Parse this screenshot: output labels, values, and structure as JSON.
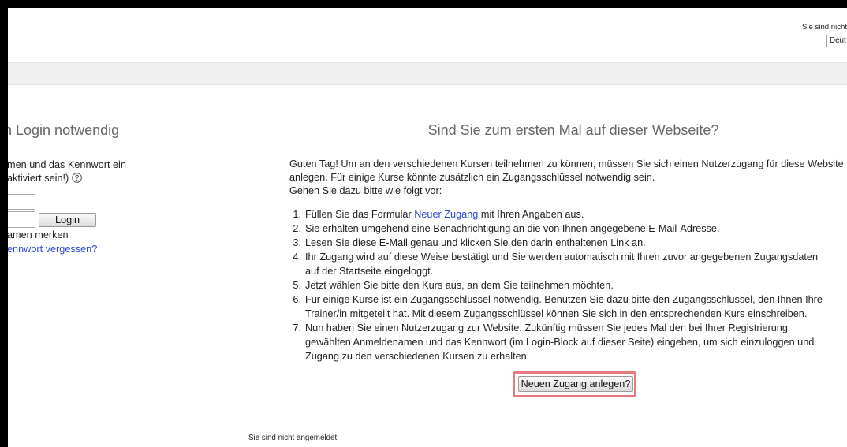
{
  "colors": {
    "text": "#222222",
    "heading": "#666666",
    "link": "#2e4bcf",
    "highlight": "#e5797e",
    "frame": "#000000",
    "navbar": "#f0f0f0"
  },
  "header": {
    "login_status": "Sie sind nicht",
    "language_select": "Deut"
  },
  "login": {
    "heading": "n Login notwendig",
    "instruction_lines": [
      "men und das Kennwort ein",
      "aktiviert sein!)"
    ],
    "help_icon": "help-icon",
    "username": "",
    "password": "",
    "login_button": "Login",
    "remember_label": "amen merken",
    "forgot_link": "ennwort vergessen?"
  },
  "signup": {
    "heading": "Sind Sie zum ersten Mal auf dieser Webseite?",
    "intro_lines": [
      "Guten Tag! Um an den verschiedenen Kursen teilnehmen zu können, müssen Sie sich einen Nutzerzugang für diese Website",
      "anlegen. Für einige Kurse könnte zusätzlich ein Zugangsschlüssel notwendig sein.",
      "Gehen Sie dazu bitte wie folgt vor:"
    ],
    "steps": [
      {
        "number": "1.",
        "text_before": "Füllen Sie das Formular ",
        "link": "Neuer Zugang",
        "text_after": " mit Ihren Angaben aus."
      },
      {
        "number": "2.",
        "lines": [
          "Sie erhalten umgehend eine Benachrichtigung an die von Ihnen angegebene E-Mail-Adresse."
        ]
      },
      {
        "number": "3.",
        "lines": [
          "Lesen Sie diese E-Mail genau und klicken Sie den darin enthaltenen Link an."
        ]
      },
      {
        "number": "4.",
        "lines": [
          "Ihr Zugang wird auf diese Weise bestätigt und Sie werden automatisch mit Ihren zuvor angegebenen Zugangsdaten",
          "auf der Startseite eingeloggt."
        ]
      },
      {
        "number": "5.",
        "lines": [
          "Jetzt wählen Sie bitte den Kurs aus, an dem Sie teilnehmen möchten."
        ]
      },
      {
        "number": "6.",
        "lines": [
          "Für einige Kurse ist ein Zugangsschlüssel notwendig. Benutzen Sie dazu bitte den Zugangsschlüssel, den Ihnen Ihre",
          "Trainer/in mitgeteilt hat. Mit diesem Zugangsschlüssel können Sie sich in den entsprechenden Kurs einschreiben."
        ]
      },
      {
        "number": "7.",
        "lines": [
          "Nun haben Sie einen Nutzerzugang zur Website. Zukünftig müssen Sie jedes Mal den bei Ihrer Registrierung",
          "gewählten Anmeldenamen und das Kennwort (im Login-Block auf dieser Seite) eingeben, um sich einzuloggen und",
          "Zugang zu den verschiedenen Kursen zu erhalten."
        ]
      }
    ],
    "create_button": "Neuen Zugang anlegen?"
  },
  "footer": {
    "login_status": "Sie sind nicht angemeldet."
  }
}
